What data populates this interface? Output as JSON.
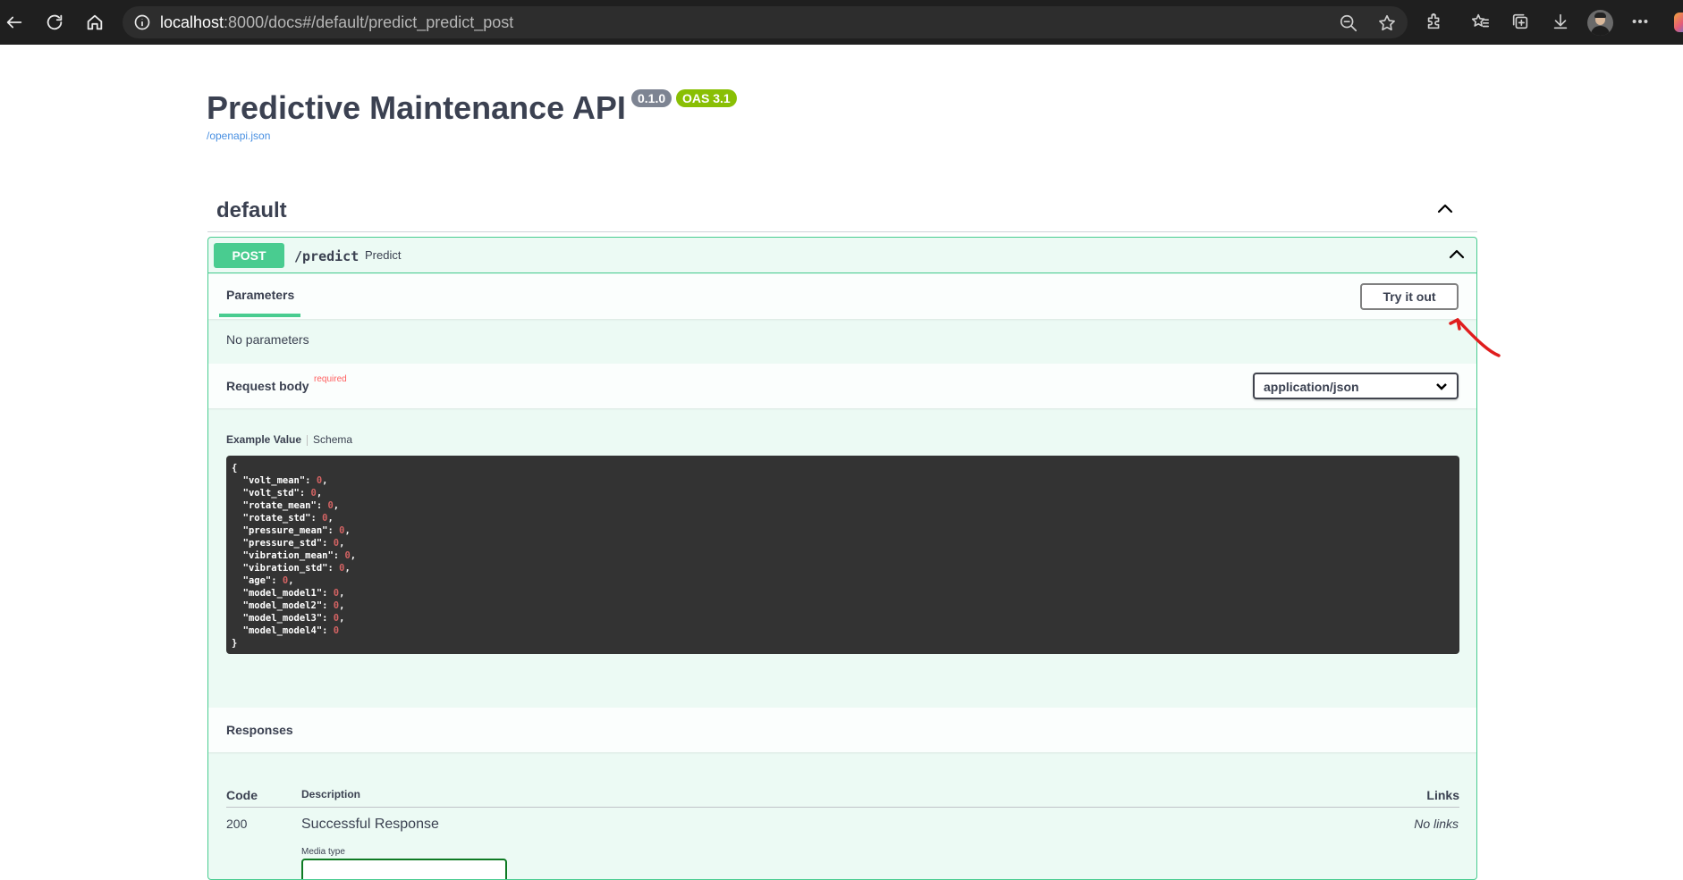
{
  "browser": {
    "url_host": "localhost",
    "url_rest": ":8000/docs#/default/predict_predict_post",
    "icons": [
      "back-icon",
      "refresh-icon",
      "home-icon",
      "info-icon",
      "zoom-out-icon",
      "favorite-star-icon",
      "extensions-icon",
      "favorites-icon",
      "collections-icon",
      "downloads-icon",
      "profile-avatar",
      "more-icon",
      "copilot-icon"
    ]
  },
  "info": {
    "title": "Predictive Maintenance API",
    "version": "0.1.0",
    "oas": "OAS 3.1",
    "spec_link": "/openapi.json"
  },
  "tag": {
    "name": "default"
  },
  "operation": {
    "method": "POST",
    "path": "/predict",
    "summary": "Predict",
    "parameters_tab": "Parameters",
    "try_button": "Try it out",
    "no_parameters": "No parameters",
    "request_body_title": "Request body",
    "required_label": "required",
    "content_type": "application/json",
    "example_tab": "Example Value",
    "schema_tab": "Schema",
    "example_fields": [
      {
        "key": "volt_mean",
        "value": "0"
      },
      {
        "key": "volt_std",
        "value": "0"
      },
      {
        "key": "rotate_mean",
        "value": "0"
      },
      {
        "key": "rotate_std",
        "value": "0"
      },
      {
        "key": "pressure_mean",
        "value": "0"
      },
      {
        "key": "pressure_std",
        "value": "0"
      },
      {
        "key": "vibration_mean",
        "value": "0"
      },
      {
        "key": "vibration_std",
        "value": "0"
      },
      {
        "key": "age",
        "value": "0"
      },
      {
        "key": "model_model1",
        "value": "0"
      },
      {
        "key": "model_model2",
        "value": "0"
      },
      {
        "key": "model_model3",
        "value": "0"
      },
      {
        "key": "model_model4",
        "value": "0"
      }
    ]
  },
  "responses": {
    "title": "Responses",
    "columns": {
      "code": "Code",
      "description": "Description",
      "links": "Links"
    },
    "rows": [
      {
        "code": "200",
        "description": "Successful Response",
        "links": "No links",
        "media_type_label": "Media type"
      }
    ]
  },
  "colors": {
    "post": "#49cc90",
    "version_badge": "#7d8492",
    "oas_badge": "#89bf04",
    "annotation": "#e01e1e"
  }
}
